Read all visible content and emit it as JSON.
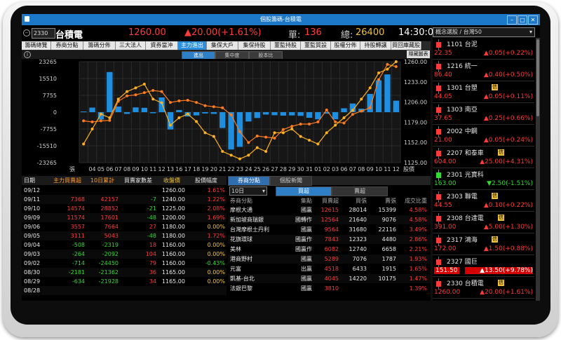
{
  "window": {
    "title": "個股籌碼-台積電",
    "code": "2330",
    "name": "台積電"
  },
  "quote": {
    "price": "1260.00",
    "change": "▲20.00(+1.61%)",
    "single_label": "單:",
    "single": "136",
    "total_label": "總:",
    "total": "26400",
    "time": "14:30:00"
  },
  "tabs": [
    "籌碼總覽",
    "券商分點",
    "籌碼分佈",
    "三大法人",
    "資券當沖",
    "主力進出",
    "集保大戶",
    "集保持股",
    "董監持股",
    "董監質設",
    "股權分佈",
    "持股轉讓",
    "買回庫藏股"
  ],
  "active_tab": 5,
  "subtabs": [
    "進出",
    "集中度",
    "股本比"
  ],
  "hide_chart_label": "隱藏圖表",
  "chart_data": {
    "type": "bar",
    "categories": [
      "03",
      "04",
      "05",
      "06",
      "07",
      "08",
      "09",
      "10",
      "11",
      "12",
      "13",
      "16",
      "17",
      "18",
      "19",
      "20",
      "21",
      "22",
      "23",
      "24",
      "25",
      "26",
      "27",
      "28",
      "29",
      "30",
      "31",
      "01",
      "02",
      "03",
      "06",
      "07",
      "08",
      "09",
      "10",
      "11",
      "12"
    ],
    "x_tick_labels": [
      "張",
      "04",
      "05",
      "06",
      "07",
      "08",
      "09",
      "10",
      "11",
      "12",
      "13",
      "16",
      "17",
      "18",
      "19",
      "20",
      "21",
      "22",
      "23",
      "24",
      "25",
      "26",
      "27",
      "28",
      "29",
      "30",
      "31",
      "01",
      "02",
      "03",
      "06",
      "07",
      "08",
      "09",
      "10",
      "11",
      "12",
      "股價"
    ],
    "series": [
      {
        "name": "主力買賣超",
        "type": "bar",
        "values": [
          300,
          2100,
          -3400,
          18500,
          2600,
          -800,
          2200,
          2000,
          -500,
          6800,
          -8000,
          1000,
          -2000,
          -1500,
          -600,
          -800,
          -7300,
          -17200,
          -16000,
          -4300,
          -2700,
          -1100,
          -1400,
          -1600,
          -1500,
          -1700,
          -2600,
          -3300,
          -700,
          -3300,
          1800,
          4000,
          1600,
          8400,
          14700,
          17400,
          5300
        ]
      },
      {
        "name": "10日累計",
        "type": "line",
        "color": "#ff7b1e",
        "values": [
          -4000,
          -4500,
          -4000,
          -3800,
          5000,
          7500,
          8000,
          9000,
          10000,
          9500,
          4500,
          5200,
          5500,
          4500,
          3000,
          2500,
          2000,
          -1200,
          -9000,
          -14000,
          -11000,
          -11500,
          -12000,
          -8000,
          -6500,
          -5500,
          -5500,
          -4500,
          1000,
          -4500,
          -5000,
          -1000,
          500,
          2000,
          15000,
          22000,
          21000
        ]
      },
      {
        "name": "股價",
        "type": "line",
        "color": "#ffb21e",
        "values": [
          1150,
          1170,
          1190,
          1185,
          1210,
          1220,
          1225,
          1230,
          1210,
          1205,
          1175,
          1185,
          1190,
          1180,
          1165,
          1160,
          1140,
          1135,
          1130,
          1135,
          1145,
          1140,
          1165,
          1165,
          1170,
          1160,
          1155,
          1150,
          1165,
          1175,
          1185,
          1195,
          1210,
          1225,
          1245,
          1250,
          1260
        ]
      }
    ],
    "yleft_ticks": [
      "23265",
      "15510",
      "7755",
      "0",
      "-7755",
      "-15510",
      "-23265"
    ],
    "yleft_lim": [
      -23265,
      23265
    ],
    "yright_ticks": [
      "1260.00",
      "1233.00",
      "1206.00",
      "1179.00",
      "1152.00",
      "1125.00"
    ],
    "yright_lim": [
      1125,
      1260
    ],
    "grid": true
  },
  "left_table": {
    "headers": [
      "日期",
      "主力買賣超",
      "10日累計",
      "買賣家數差",
      "收盤價",
      "股價幅度"
    ],
    "rows": [
      [
        "09/12",
        "",
        "",
        "",
        "1260.00",
        "1.61%"
      ],
      [
        "09/11",
        "7368",
        "42157",
        "-7",
        "1240.00",
        "1.22%"
      ],
      [
        "09/10",
        "14574",
        "28852",
        "-21",
        "1225.00",
        "2.08%"
      ],
      [
        "09/09",
        "11574",
        "17601",
        "-48",
        "1200.00",
        "1.69%"
      ],
      [
        "09/06",
        "3557",
        "7664",
        "27",
        "1180.00",
        "0.00%"
      ],
      [
        "09/05",
        "3111",
        "5043",
        "-48",
        "1180.00",
        "1.72%"
      ],
      [
        "09/04",
        "-508",
        "-2319",
        "18",
        "1160.00",
        "0.00%"
      ],
      [
        "09/03",
        "-264",
        "-2092",
        "104",
        "1160.00",
        "0.00%"
      ],
      [
        "09/02",
        "-714",
        "-24450",
        "79",
        "1160.00",
        "-0.43%"
      ],
      [
        "08/30",
        "-2181",
        "-21362",
        "36",
        "1165.00",
        "0.00%"
      ],
      [
        "08/29",
        "-634",
        "-21928",
        "34",
        "1165.00",
        "0.00%"
      ],
      [
        "08/28",
        "",
        "",
        "",
        "",
        "",
        ""
      ]
    ]
  },
  "right_panel": {
    "tabs": [
      "券商分點",
      "個股新聞"
    ],
    "period": "10日",
    "subtabs": [
      "買超",
      "賣超"
    ],
    "headers": [
      "券商分點",
      "集點",
      "買賣超",
      "買張",
      "賣張",
      "成交比重"
    ],
    "rows": [
      [
        "摩根大通",
        "國贏",
        "12615",
        "28014",
        "15399",
        "4.58%"
      ],
      [
        "新加坡商瑞銀",
        "國轉作",
        "12564",
        "21640",
        "9076",
        "4.58%"
      ],
      [
        "台灣摩根士丹利",
        "國贏",
        "9564",
        "31680",
        "22116",
        "3.49%"
      ],
      [
        "花旗環球",
        "國贏作",
        "7843",
        "12323",
        "4480",
        "2.86%"
      ],
      [
        "美林",
        "國贏作",
        "6082",
        "12740",
        "6658",
        "2.21%"
      ],
      [
        "港商野村",
        "國贏",
        "5289",
        "7076",
        "1787",
        "1.93%"
      ],
      [
        "元富",
        "出贏",
        "4518",
        "6433",
        "1915",
        "1.65%"
      ],
      [
        "凱基-台北",
        "國贏",
        "4045",
        "14220",
        "10175",
        "1.47%"
      ],
      [
        "法銀巴黎",
        "國贏",
        "3810",
        "",
        "",
        "1.39%"
      ]
    ]
  },
  "side": {
    "header": "概念選股 / 台灣50",
    "items": [
      {
        "code": "1101",
        "name": "台泥",
        "badge": "",
        "price": "22.35",
        "change": "▲0.05(+0.22%)",
        "price_color": "red",
        "hl": false
      },
      {
        "code": "1216",
        "name": "統一",
        "badge": "",
        "price": "86.40",
        "change": "▲0.40(+0.50%)",
        "price_color": "red",
        "hl": false
      },
      {
        "code": "1301",
        "name": "台塑",
        "badge": "信",
        "price": "44.05",
        "change": "▲0.05(+0.11%)",
        "price_color": "red",
        "hl": false
      },
      {
        "code": "1303",
        "name": "南亞",
        "badge": "",
        "price": "37.65",
        "change": "▲0.25(+0.66%)",
        "price_color": "red",
        "hl": false
      },
      {
        "code": "2002",
        "name": "中鋼",
        "badge": "",
        "price": "21.00",
        "change": "▲0.05(+0.24%)",
        "price_color": "red",
        "hl": false
      },
      {
        "code": "2207",
        "name": "和泰車",
        "badge": "信",
        "price": "604.00",
        "change": "▲25.00(+4.31%)",
        "price_color": "red",
        "hl": false
      },
      {
        "code": "2301",
        "name": "光寶科",
        "badge": "",
        "price": "163.00",
        "change": "▼2.50(-1.51%)",
        "price_color": "green",
        "hl": false
      },
      {
        "code": "2303",
        "name": "聯電",
        "badge": "信",
        "price": "44.55",
        "change": "▲0.10(+0.22%)",
        "price_color": "red",
        "hl": false
      },
      {
        "code": "2308",
        "name": "台達電",
        "badge": "信",
        "price": "391.00",
        "change": "▲5.00(+1.30%)",
        "price_color": "red",
        "hl": false
      },
      {
        "code": "2317",
        "name": "鴻海",
        "badge": "信",
        "price": "172.00",
        "change": "▲1.50(+0.88%)",
        "price_color": "red",
        "hl": false
      },
      {
        "code": "2327",
        "name": "國巨",
        "badge": "",
        "price": "151.50",
        "change": "▲13.50(+9.78%)",
        "price_color": "red",
        "hl": true
      },
      {
        "code": "2330",
        "name": "台積電",
        "badge": "信",
        "price": "1260.00",
        "change": "▲20.00(+1.61%)",
        "price_color": "red",
        "hl": false
      }
    ]
  }
}
